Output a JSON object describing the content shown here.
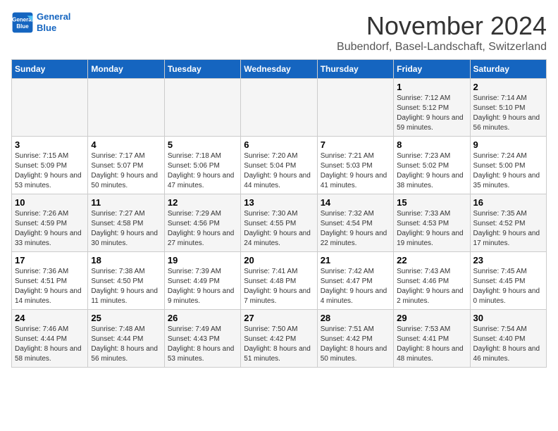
{
  "header": {
    "logo_line1": "General",
    "logo_line2": "Blue",
    "month_title": "November 2024",
    "location": "Bubendorf, Basel-Landschaft, Switzerland"
  },
  "weekdays": [
    "Sunday",
    "Monday",
    "Tuesday",
    "Wednesday",
    "Thursday",
    "Friday",
    "Saturday"
  ],
  "weeks": [
    [
      {
        "day": "",
        "info": ""
      },
      {
        "day": "",
        "info": ""
      },
      {
        "day": "",
        "info": ""
      },
      {
        "day": "",
        "info": ""
      },
      {
        "day": "",
        "info": ""
      },
      {
        "day": "1",
        "info": "Sunrise: 7:12 AM\nSunset: 5:12 PM\nDaylight: 9 hours and 59 minutes."
      },
      {
        "day": "2",
        "info": "Sunrise: 7:14 AM\nSunset: 5:10 PM\nDaylight: 9 hours and 56 minutes."
      }
    ],
    [
      {
        "day": "3",
        "info": "Sunrise: 7:15 AM\nSunset: 5:09 PM\nDaylight: 9 hours and 53 minutes."
      },
      {
        "day": "4",
        "info": "Sunrise: 7:17 AM\nSunset: 5:07 PM\nDaylight: 9 hours and 50 minutes."
      },
      {
        "day": "5",
        "info": "Sunrise: 7:18 AM\nSunset: 5:06 PM\nDaylight: 9 hours and 47 minutes."
      },
      {
        "day": "6",
        "info": "Sunrise: 7:20 AM\nSunset: 5:04 PM\nDaylight: 9 hours and 44 minutes."
      },
      {
        "day": "7",
        "info": "Sunrise: 7:21 AM\nSunset: 5:03 PM\nDaylight: 9 hours and 41 minutes."
      },
      {
        "day": "8",
        "info": "Sunrise: 7:23 AM\nSunset: 5:02 PM\nDaylight: 9 hours and 38 minutes."
      },
      {
        "day": "9",
        "info": "Sunrise: 7:24 AM\nSunset: 5:00 PM\nDaylight: 9 hours and 35 minutes."
      }
    ],
    [
      {
        "day": "10",
        "info": "Sunrise: 7:26 AM\nSunset: 4:59 PM\nDaylight: 9 hours and 33 minutes."
      },
      {
        "day": "11",
        "info": "Sunrise: 7:27 AM\nSunset: 4:58 PM\nDaylight: 9 hours and 30 minutes."
      },
      {
        "day": "12",
        "info": "Sunrise: 7:29 AM\nSunset: 4:56 PM\nDaylight: 9 hours and 27 minutes."
      },
      {
        "day": "13",
        "info": "Sunrise: 7:30 AM\nSunset: 4:55 PM\nDaylight: 9 hours and 24 minutes."
      },
      {
        "day": "14",
        "info": "Sunrise: 7:32 AM\nSunset: 4:54 PM\nDaylight: 9 hours and 22 minutes."
      },
      {
        "day": "15",
        "info": "Sunrise: 7:33 AM\nSunset: 4:53 PM\nDaylight: 9 hours and 19 minutes."
      },
      {
        "day": "16",
        "info": "Sunrise: 7:35 AM\nSunset: 4:52 PM\nDaylight: 9 hours and 17 minutes."
      }
    ],
    [
      {
        "day": "17",
        "info": "Sunrise: 7:36 AM\nSunset: 4:51 PM\nDaylight: 9 hours and 14 minutes."
      },
      {
        "day": "18",
        "info": "Sunrise: 7:38 AM\nSunset: 4:50 PM\nDaylight: 9 hours and 11 minutes."
      },
      {
        "day": "19",
        "info": "Sunrise: 7:39 AM\nSunset: 4:49 PM\nDaylight: 9 hours and 9 minutes."
      },
      {
        "day": "20",
        "info": "Sunrise: 7:41 AM\nSunset: 4:48 PM\nDaylight: 9 hours and 7 minutes."
      },
      {
        "day": "21",
        "info": "Sunrise: 7:42 AM\nSunset: 4:47 PM\nDaylight: 9 hours and 4 minutes."
      },
      {
        "day": "22",
        "info": "Sunrise: 7:43 AM\nSunset: 4:46 PM\nDaylight: 9 hours and 2 minutes."
      },
      {
        "day": "23",
        "info": "Sunrise: 7:45 AM\nSunset: 4:45 PM\nDaylight: 9 hours and 0 minutes."
      }
    ],
    [
      {
        "day": "24",
        "info": "Sunrise: 7:46 AM\nSunset: 4:44 PM\nDaylight: 8 hours and 58 minutes."
      },
      {
        "day": "25",
        "info": "Sunrise: 7:48 AM\nSunset: 4:44 PM\nDaylight: 8 hours and 56 minutes."
      },
      {
        "day": "26",
        "info": "Sunrise: 7:49 AM\nSunset: 4:43 PM\nDaylight: 8 hours and 53 minutes."
      },
      {
        "day": "27",
        "info": "Sunrise: 7:50 AM\nSunset: 4:42 PM\nDaylight: 8 hours and 51 minutes."
      },
      {
        "day": "28",
        "info": "Sunrise: 7:51 AM\nSunset: 4:42 PM\nDaylight: 8 hours and 50 minutes."
      },
      {
        "day": "29",
        "info": "Sunrise: 7:53 AM\nSunset: 4:41 PM\nDaylight: 8 hours and 48 minutes."
      },
      {
        "day": "30",
        "info": "Sunrise: 7:54 AM\nSunset: 4:40 PM\nDaylight: 8 hours and 46 minutes."
      }
    ]
  ]
}
